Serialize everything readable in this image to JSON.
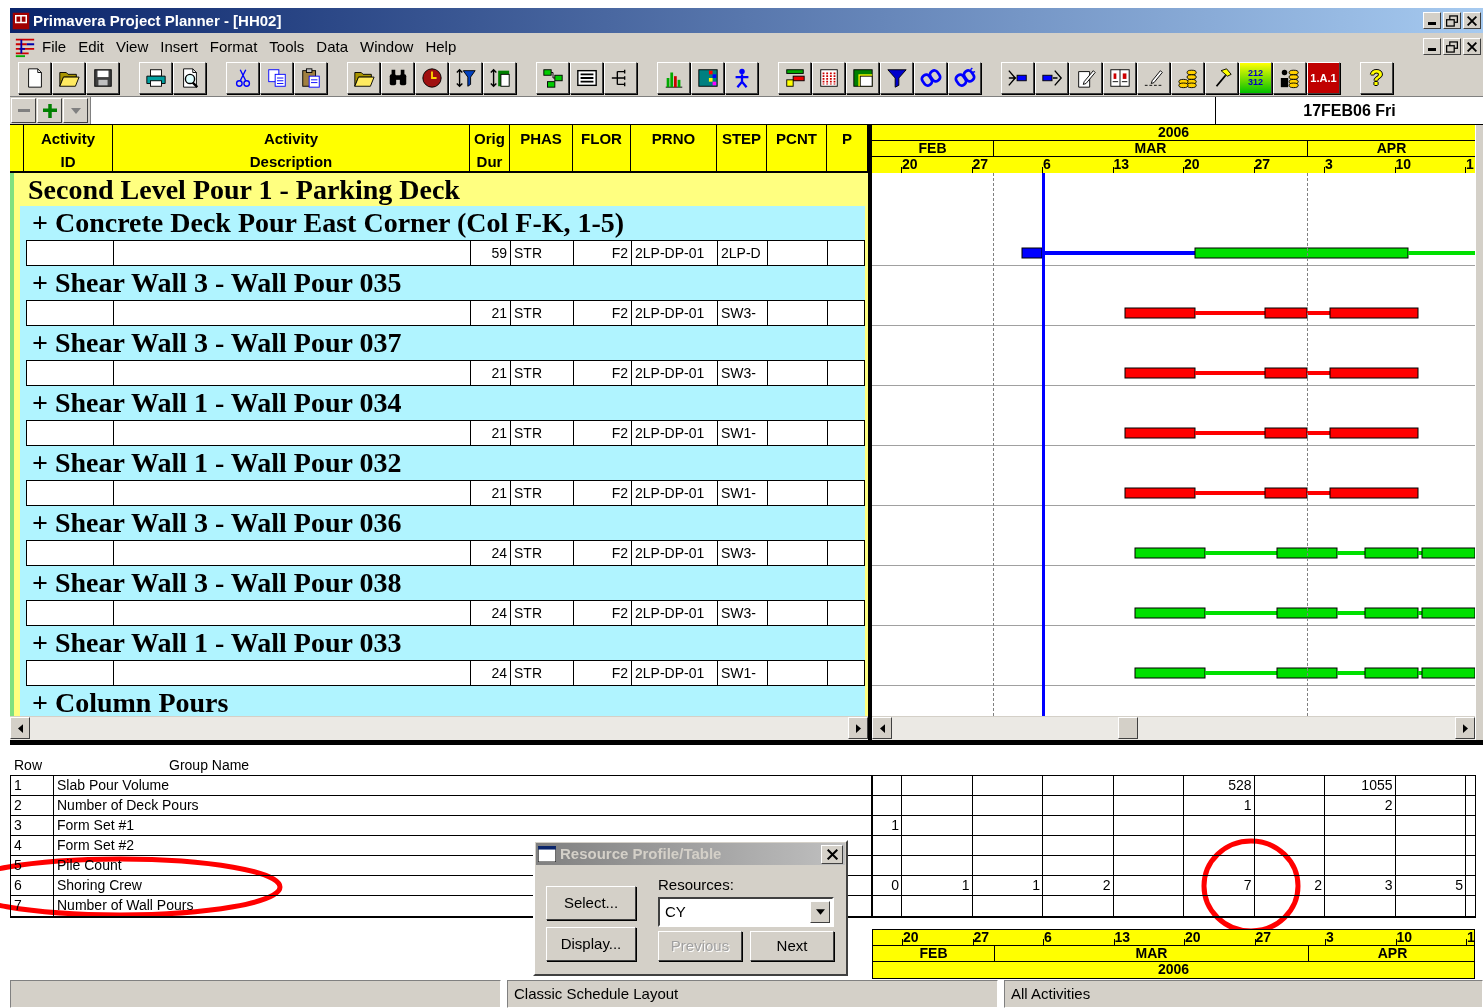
{
  "window": {
    "title": "Primavera Project Planner - [HH02]"
  },
  "menu": [
    {
      "label": "File"
    },
    {
      "label": "Edit"
    },
    {
      "label": "View"
    },
    {
      "label": "Insert"
    },
    {
      "label": "Format"
    },
    {
      "label": "Tools"
    },
    {
      "label": "Data"
    },
    {
      "label": "Window"
    },
    {
      "label": "Help"
    }
  ],
  "toolbar": {
    "number_grid_lines": [
      "212",
      "312"
    ],
    "outline_label": "1.A.1",
    "help_label": "?"
  },
  "edit_bar": {
    "current_date": "17FEB06 Fri"
  },
  "columns": [
    {
      "lines": [
        "Activity",
        "ID"
      ]
    },
    {
      "lines": [
        "Activity",
        "Description"
      ]
    },
    {
      "lines": [
        "Orig",
        "Dur"
      ]
    },
    {
      "lines": [
        "PHAS"
      ]
    },
    {
      "lines": [
        "FLOR"
      ]
    },
    {
      "lines": [
        "PRNO"
      ]
    },
    {
      "lines": [
        "STEP"
      ]
    },
    {
      "lines": [
        "PCNT"
      ]
    },
    {
      "lines": [
        "P"
      ]
    }
  ],
  "timescale": {
    "year": "2006",
    "months": [
      "FEB",
      "MAR",
      "APR"
    ],
    "weeks": [
      "20",
      "27",
      "6",
      "13",
      "20",
      "27",
      "3",
      "10",
      "1"
    ]
  },
  "groups": [
    {
      "title": "Second Level Pour 1 - Parking Deck",
      "children": [
        {
          "title": "+ Concrete Deck Pour East Corner (Col F-K, 1-5)",
          "activities": [
            {
              "cells": {
                "orig_dur": "59",
                "phas": "STR",
                "flor": "F2",
                "prno": "2LP-DP-01",
                "step": "2LP-D"
              },
              "kind": "in_progress"
            }
          ]
        },
        {
          "title": "+ Shear Wall 3 - Wall Pour 035",
          "activities": [
            {
              "cells": {
                "orig_dur": "21",
                "phas": "STR",
                "flor": "F2",
                "prno": "2LP-DP-01",
                "step": "SW3-"
              },
              "kind": "critical"
            }
          ]
        },
        {
          "title": "+ Shear Wall 3 - Wall Pour 037",
          "activities": [
            {
              "cells": {
                "orig_dur": "21",
                "phas": "STR",
                "flor": "F2",
                "prno": "2LP-DP-01",
                "step": "SW3-"
              },
              "kind": "critical"
            }
          ]
        },
        {
          "title": "+ Shear Wall 1 - Wall Pour 034",
          "activities": [
            {
              "cells": {
                "orig_dur": "21",
                "phas": "STR",
                "flor": "F2",
                "prno": "2LP-DP-01",
                "step": "SW1-"
              },
              "kind": "critical"
            }
          ]
        },
        {
          "title": "+ Shear Wall 1 - Wall Pour 032",
          "activities": [
            {
              "cells": {
                "orig_dur": "21",
                "phas": "STR",
                "flor": "F2",
                "prno": "2LP-DP-01",
                "step": "SW1-"
              },
              "kind": "critical"
            }
          ]
        },
        {
          "title": "+ Shear Wall 3 - Wall Pour 036",
          "activities": [
            {
              "cells": {
                "orig_dur": "24",
                "phas": "STR",
                "flor": "F2",
                "prno": "2LP-DP-01",
                "step": "SW3-"
              },
              "kind": "normal"
            }
          ]
        },
        {
          "title": "+ Shear Wall 3 - Wall Pour 038",
          "activities": [
            {
              "cells": {
                "orig_dur": "24",
                "phas": "STR",
                "flor": "F2",
                "prno": "2LP-DP-01",
                "step": "SW3-"
              },
              "kind": "normal"
            }
          ]
        },
        {
          "title": "+ Shear Wall 1 - Wall Pour 033",
          "activities": [
            {
              "cells": {
                "orig_dur": "24",
                "phas": "STR",
                "flor": "F2",
                "prno": "2LP-DP-01",
                "step": "SW1-"
              },
              "kind": "normal"
            }
          ]
        },
        {
          "title": "+ Column Pours"
        }
      ]
    }
  ],
  "resource_table": {
    "columns": [
      "Row",
      "Group Name"
    ],
    "rows": [
      {
        "row": "1",
        "group_name": "Slab Pour Volume",
        "values": {
          "column_6": "528",
          "column_8": "1055"
        }
      },
      {
        "row": "2",
        "group_name": "Number of Deck Pours",
        "values": {
          "column_6": "1",
          "column_8": "2"
        }
      },
      {
        "row": "3",
        "group_name": "Form Set #1",
        "values": {
          "column_1": "1"
        }
      },
      {
        "row": "4",
        "group_name": "Form Set #2"
      },
      {
        "row": "5",
        "group_name": "Pile Count"
      },
      {
        "row": "6",
        "group_name": "Shoring Crew",
        "values": {
          "column_1": "0",
          "column_2": "1",
          "column_3": "1",
          "column_4": "2",
          "column_6": "7",
          "column_7": "2",
          "column_8": "3",
          "column_9": "5"
        }
      },
      {
        "row": "7",
        "group_name": "Number of Wall Pours"
      }
    ]
  },
  "bottom_timescale": {
    "weeks": [
      "20",
      "27",
      "6",
      "13",
      "20",
      "27",
      "3",
      "10",
      "1"
    ],
    "months": [
      "FEB",
      "MAR",
      "APR"
    ],
    "year": "2006"
  },
  "resource_dialog": {
    "title": "Resource Profile/Table",
    "active": false,
    "buttons": [
      {
        "label": "Select..."
      },
      {
        "label": "Display..."
      }
    ],
    "resources_label": "Resources:",
    "resources_value": "CY",
    "nav_buttons": [
      {
        "label": "Previous",
        "disabled": true
      },
      {
        "label": "Next",
        "disabled": false
      }
    ]
  },
  "status_bar": {
    "panels": [
      {
        "text": "Classic Schedule Layout"
      },
      {
        "text": "All Activities"
      }
    ]
  }
}
